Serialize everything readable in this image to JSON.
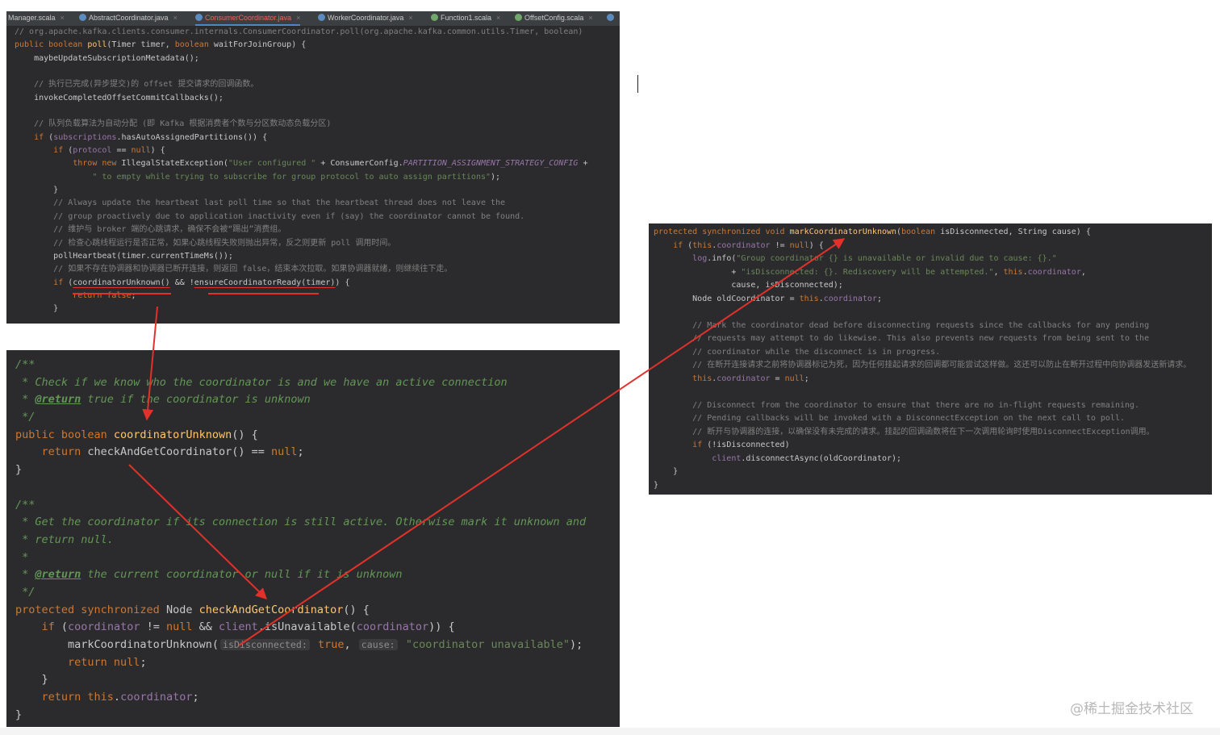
{
  "tabs": [
    {
      "label": "Manager.scala",
      "icon": "scala-file-icon",
      "active": false
    },
    {
      "label": "AbstractCoordinator.java",
      "icon": "java-class-icon",
      "active": false
    },
    {
      "label": "ConsumerCoordinator.java",
      "icon": "java-class-icon",
      "active": true
    },
    {
      "label": "WorkerCoordinator.java",
      "icon": "java-class-icon",
      "active": false
    },
    {
      "label": "Function1.scala",
      "icon": "scala-file-icon",
      "active": false
    },
    {
      "label": "OffsetConfig.scala",
      "icon": "scala-file-icon",
      "active": false
    }
  ],
  "tab_close_glyph": "×",
  "top_code": [
    [
      [
        "// org.apache.kafka.clients.consumer.internals.ConsumerCoordinator.poll(org.apache.kafka.common.utils.Timer, boolean)",
        "cm"
      ]
    ],
    [
      [
        "public boolean ",
        "kw"
      ],
      [
        "poll",
        "fn"
      ],
      [
        "(Timer timer, ",
        ""
      ],
      [
        "boolean ",
        "kw"
      ],
      [
        "waitForJoinGroup) {",
        ""
      ]
    ],
    [
      [
        "    maybeUpdateSubscriptionMetadata();",
        ""
      ]
    ],
    [],
    [
      [
        "    // 执行已完成(异步提交)的 offset 提交请求的回调函数。",
        "cm"
      ]
    ],
    [
      [
        "    invokeCompletedOffsetCommitCallbacks();",
        ""
      ]
    ],
    [],
    [
      [
        "    // 队列负载算法为自动分配 (即 Kafka 根据消费者个数与分区数动态负载分区)",
        "cm"
      ]
    ],
    [
      [
        "    ",
        ""
      ],
      [
        "if ",
        "kw"
      ],
      [
        "(",
        ""
      ],
      [
        "subscriptions",
        "fld"
      ],
      [
        ".hasAutoAssignedPartitions()) {",
        ""
      ]
    ],
    [
      [
        "        ",
        ""
      ],
      [
        "if ",
        "kw"
      ],
      [
        "(",
        ""
      ],
      [
        "protocol",
        "fld"
      ],
      [
        " == ",
        ""
      ],
      [
        "null",
        "kw"
      ],
      [
        ") {",
        ""
      ]
    ],
    [
      [
        "            ",
        ""
      ],
      [
        "throw new ",
        "kw"
      ],
      [
        "IllegalStateException(",
        ""
      ],
      [
        "\"User configured \"",
        "str"
      ],
      [
        " + ConsumerConfig.",
        ""
      ],
      [
        "PARTITION_ASSIGNMENT_STRATEGY_CONFIG",
        "cst"
      ],
      [
        " +",
        ""
      ]
    ],
    [
      [
        "                ",
        ""
      ],
      [
        "\" to empty while trying to subscribe for group protocol to auto assign partitions\"",
        "str"
      ],
      [
        ");",
        ""
      ]
    ],
    [
      [
        "        }",
        ""
      ]
    ],
    [
      [
        "        // Always update the heartbeat last poll time so that the heartbeat thread does not leave the",
        "cm"
      ]
    ],
    [
      [
        "        // group proactively due to application inactivity even if (say) the coordinator cannot be found.",
        "cm"
      ]
    ],
    [
      [
        "        // 维护与 broker 端的心跳请求，确保不会被“踢出”消费组。",
        "cm"
      ]
    ],
    [
      [
        "        // 检查心跳线程运行是否正常，如果心跳线程失败则抛出异常，反之则更新 poll 调用时间。",
        "cm"
      ]
    ],
    [
      [
        "        pollHeartbeat(timer.currentTimeMs());",
        ""
      ]
    ],
    [
      [
        "        // 如果不存在协调器和协调器已断开连接，则返回 false，结束本次拉取。如果协调器就绪，则继续往下走。",
        "cm"
      ]
    ],
    [
      [
        "        ",
        ""
      ],
      [
        "if ",
        "kw"
      ],
      [
        "(",
        ""
      ],
      [
        "coordinatorUnknown()",
        "uline"
      ],
      [
        " && !",
        ""
      ],
      [
        "ensureCoordinatorReady(timer)",
        "uline"
      ],
      [
        ") {",
        ""
      ]
    ],
    [
      [
        "            ",
        ""
      ],
      [
        "return false",
        "kw"
      ],
      [
        ";",
        ""
      ]
    ],
    [
      [
        "        }",
        ""
      ]
    ]
  ],
  "left_code": [
    [
      [
        "/**",
        "jd"
      ]
    ],
    [
      [
        " * Check if we know who the coordinator is and we have an active connection",
        "jd"
      ]
    ],
    [
      [
        " * ",
        "jd"
      ],
      [
        "@return",
        "jt"
      ],
      [
        " true if the coordinator is unknown",
        "jd"
      ]
    ],
    [
      [
        " */",
        "jd"
      ]
    ],
    [
      [
        "public boolean ",
        "kw"
      ],
      [
        "coordinatorUnknown",
        "fn"
      ],
      [
        "() {",
        ""
      ]
    ],
    [
      [
        "    ",
        ""
      ],
      [
        "return ",
        "kw"
      ],
      [
        "checkAndGetCoordinator() == ",
        ""
      ],
      [
        "null",
        "kw"
      ],
      [
        ";",
        ""
      ]
    ],
    [
      [
        "}",
        ""
      ]
    ],
    [],
    [
      [
        "/**",
        "jd"
      ]
    ],
    [
      [
        " * Get the coordinator if its connection is still active. Otherwise mark it unknown and",
        "jd"
      ]
    ],
    [
      [
        " * return null.",
        "jd"
      ]
    ],
    [
      [
        " *",
        "jd"
      ]
    ],
    [
      [
        " * ",
        "jd"
      ],
      [
        "@return",
        "jt"
      ],
      [
        " the current coordinator or null if it is unknown",
        "jd"
      ]
    ],
    [
      [
        " */",
        "jd"
      ]
    ],
    [
      [
        "protected synchronized ",
        "kw"
      ],
      [
        "Node ",
        ""
      ],
      [
        "checkAndGetCoordinator",
        "fn"
      ],
      [
        "() {",
        ""
      ]
    ],
    [
      [
        "    ",
        ""
      ],
      [
        "if ",
        "kw"
      ],
      [
        "(",
        ""
      ],
      [
        "coordinator",
        "fld"
      ],
      [
        " != ",
        ""
      ],
      [
        "null ",
        "kw"
      ],
      [
        "&& ",
        ""
      ],
      [
        "client",
        "fld"
      ],
      [
        ".isUnavailable(",
        ""
      ],
      [
        "coordinator",
        "fld"
      ],
      [
        ")) {",
        ""
      ]
    ],
    [
      [
        "        markCoordinatorUnknown(",
        ""
      ],
      [
        "isDisconnected:",
        "hint"
      ],
      [
        " ",
        ""
      ],
      [
        "true",
        "kw"
      ],
      [
        ", ",
        ""
      ],
      [
        "cause:",
        "hint"
      ],
      [
        " ",
        ""
      ],
      [
        "\"coordinator unavailable\"",
        "str"
      ],
      [
        ");",
        ""
      ]
    ],
    [
      [
        "        ",
        ""
      ],
      [
        "return null",
        "kw"
      ],
      [
        ";",
        ""
      ]
    ],
    [
      [
        "    }",
        ""
      ]
    ],
    [
      [
        "    ",
        ""
      ],
      [
        "return this",
        "kw"
      ],
      [
        ".",
        ""
      ],
      [
        "coordinator",
        "fld"
      ],
      [
        ";",
        ""
      ]
    ],
    [
      [
        "}",
        ""
      ]
    ]
  ],
  "right_code": [
    [
      [
        "protected synchronized void ",
        "kw"
      ],
      [
        "markCoordinatorUnknown",
        "fn"
      ],
      [
        "(",
        ""
      ],
      [
        "boolean ",
        "kw"
      ],
      [
        "isDisconnected, String cause) {",
        ""
      ]
    ],
    [
      [
        "    ",
        ""
      ],
      [
        "if ",
        "kw"
      ],
      [
        "(",
        ""
      ],
      [
        "this",
        "kw"
      ],
      [
        ".",
        ""
      ],
      [
        "coordinator",
        "fld"
      ],
      [
        " != ",
        ""
      ],
      [
        "null",
        "kw"
      ],
      [
        ") {",
        ""
      ]
    ],
    [
      [
        "        ",
        ""
      ],
      [
        "log",
        "fld"
      ],
      [
        ".info(",
        ""
      ],
      [
        "\"Group coordinator {} is unavailable or invalid due to cause: {}.\"",
        "str"
      ]
    ],
    [
      [
        "                + ",
        ""
      ],
      [
        "\"isDisconnected: {}. Rediscovery will be attempted.\"",
        "str"
      ],
      [
        ", ",
        ""
      ],
      [
        "this",
        "kw"
      ],
      [
        ".",
        ""
      ],
      [
        "coordinator",
        "fld"
      ],
      [
        ",",
        ""
      ]
    ],
    [
      [
        "                cause, isDisconnected);",
        ""
      ]
    ],
    [
      [
        "        Node oldCoordinator = ",
        ""
      ],
      [
        "this",
        "kw"
      ],
      [
        ".",
        ""
      ],
      [
        "coordinator",
        "fld"
      ],
      [
        ";",
        ""
      ]
    ],
    [],
    [
      [
        "        // Mark the coordinator dead before disconnecting requests since the callbacks for any pending",
        "cm"
      ]
    ],
    [
      [
        "        // requests may attempt to do likewise. This also prevents new requests from being sent to the",
        "cm"
      ]
    ],
    [
      [
        "        // coordinator while the disconnect is in progress.",
        "cm"
      ]
    ],
    [
      [
        "        // 在断开连接请求之前将协调器标记为死，因为任何挂起请求的回调都可能尝试这样做。这还可以防止在断开过程中向协调器发送新请求。",
        "cm"
      ]
    ],
    [
      [
        "        ",
        ""
      ],
      [
        "this",
        "kw"
      ],
      [
        ".",
        ""
      ],
      [
        "coordinator",
        "fld"
      ],
      [
        " = ",
        ""
      ],
      [
        "null",
        "kw"
      ],
      [
        ";",
        ""
      ]
    ],
    [],
    [
      [
        "        // Disconnect from the coordinator to ensure that there are no in-flight requests remaining.",
        "cm"
      ]
    ],
    [
      [
        "        // Pending callbacks will be invoked with a DisconnectException on the next call to poll.",
        "cm"
      ]
    ],
    [
      [
        "        // 断开与协调器的连接，以确保没有未完成的请求。挂起的回调函数将在下一次调用轮询时使用DisconnectException调用。",
        "cm"
      ]
    ],
    [
      [
        "        ",
        ""
      ],
      [
        "if ",
        "kw"
      ],
      [
        "(!isDisconnected)",
        ""
      ]
    ],
    [
      [
        "            ",
        ""
      ],
      [
        "client",
        "fld"
      ],
      [
        ".disconnectAsync(oldCoordinator);",
        ""
      ]
    ],
    [
      [
        "    }",
        ""
      ]
    ],
    [
      [
        "}",
        ""
      ]
    ]
  ],
  "watermark": "@稀土掘金技术社区",
  "colors": {
    "editor_bg": "#2b2b2d",
    "keyword": "#cc7832",
    "method": "#ffc66d",
    "comment": "#808080",
    "string": "#6a8759",
    "field": "#9876aa",
    "doc": "#629755",
    "annotation_arrow": "#e2312a",
    "active_tab": "#e2685f"
  }
}
